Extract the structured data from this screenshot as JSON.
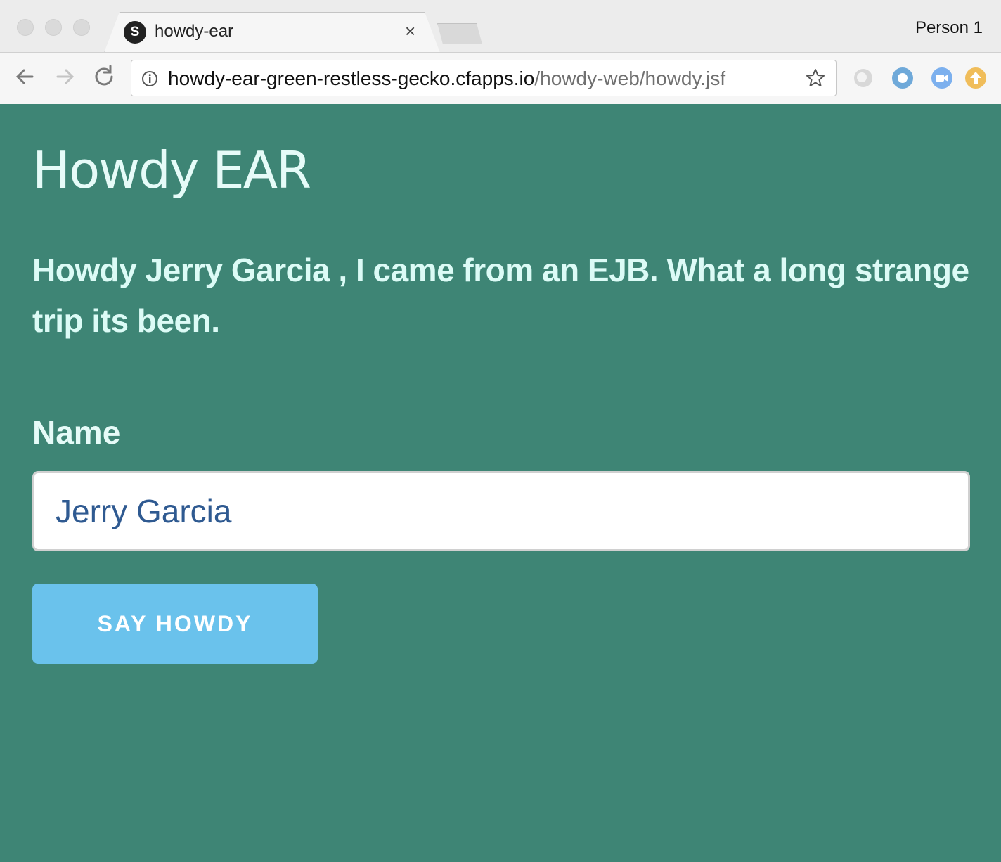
{
  "window": {
    "tab_title": "howdy-ear",
    "favicon_letter": "S",
    "profile_name": "Person 1"
  },
  "address_bar": {
    "host": "howdy-ear-green-restless-gecko.cfapps.io",
    "path": "/howdy-web/howdy.jsf"
  },
  "extensions": [
    {
      "name": "grey-extension-icon",
      "color": "#cfcfcf"
    },
    {
      "name": "blue-ring-extension-icon",
      "color": "#6fa9d9"
    },
    {
      "name": "video-extension-icon",
      "color": "#7cb0ee"
    },
    {
      "name": "upload-extension-icon",
      "color": "#f0bd5a"
    }
  ],
  "page": {
    "title": "Howdy EAR",
    "greeting": "Howdy Jerry Garcia , I came from an EJB. What a long strange trip its been.",
    "name_label": "Name",
    "name_value": "Jerry Garcia",
    "submit_label": "SAY HOWDY"
  },
  "colors": {
    "background": "#3e8575",
    "button": "#6ac2ec",
    "input_text": "#2f5a91"
  }
}
